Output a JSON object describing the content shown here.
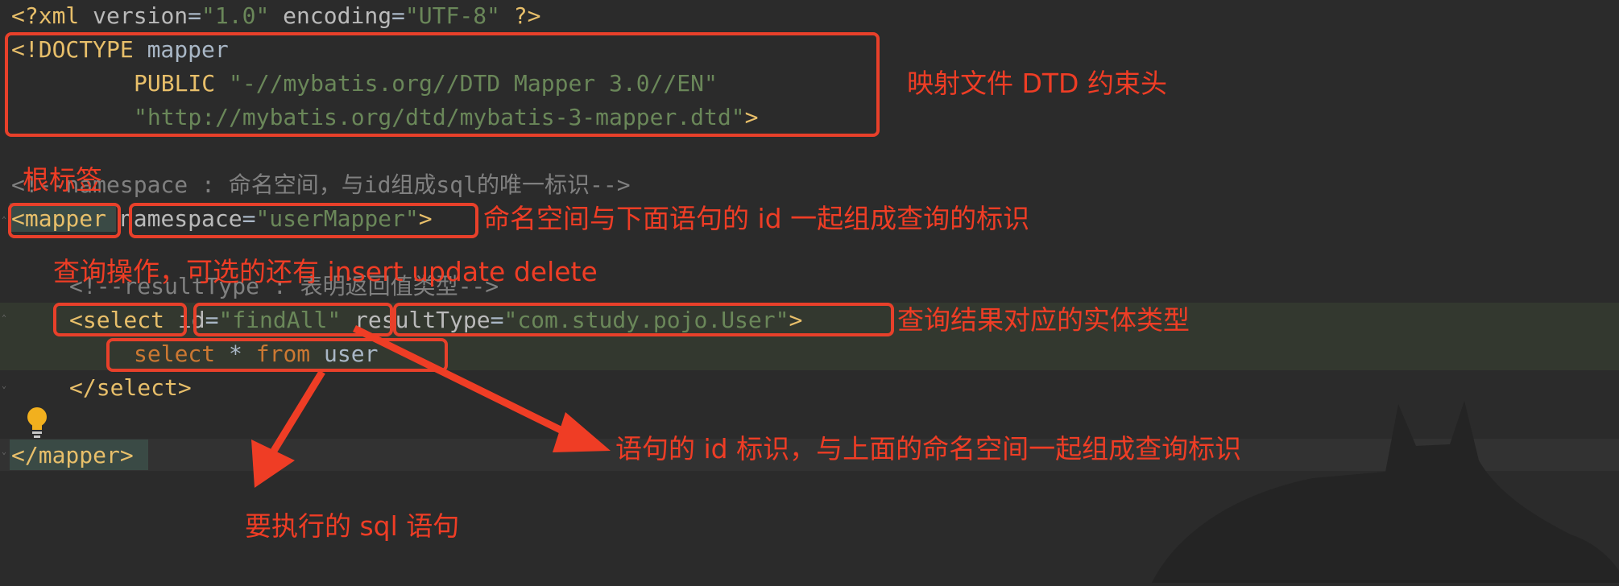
{
  "code": {
    "line1": {
      "open": "<?xml ",
      "attr1": "version",
      "eq1": "=",
      "val1": "\"1.0\"",
      "attr2": " encoding",
      "eq2": "=",
      "val2": "\"UTF-8\"",
      "close": " ?>"
    },
    "line2": {
      "tag": "<!DOCTYPE",
      "rest": " mapper"
    },
    "line3": {
      "kw": "PUBLIC",
      "val": " \"-//mybatis.org//DTD Mapper 3.0//EN\""
    },
    "line4": {
      "val": "\"http://mybatis.org/dtd/mybatis-3-mapper.dtd\"",
      "close": ">"
    },
    "line5": {
      "comment": "<!--namespace : 命名空间，与id组成sql的唯一标识-->"
    },
    "line6": {
      "tag": "<mapper",
      "attr": " namespace",
      "eq": "=",
      "val": "\"userMapper\"",
      "close": ">"
    },
    "line7": {
      "comment": "<!--resultType : 表明返回值类型-->"
    },
    "line8": {
      "tag": "<select",
      "attr1": " id",
      "eq1": "=",
      "val1": "\"findAll\"",
      "attr2": " resultType",
      "eq2": "=",
      "val2": "\"com.study.pojo.User\"",
      "close": ">"
    },
    "line9": {
      "kw1": "select",
      "star": " * ",
      "kw2": "from",
      "rest": " user"
    },
    "line10": {
      "tag": "</select>"
    },
    "line11": {
      "tag": "</mapper>"
    }
  },
  "annotations": {
    "dtd": "映射文件 DTD 约束头",
    "root": "根标签",
    "namespace": "命名空间与下面语句的 id 一起组成查询的标识",
    "select_op": "查询操作，可选的还有 insert update delete",
    "result_type": "查询结果对应的实体类型",
    "statement_id": "语句的 id 标识，与上面的命名空间一起组成查询标识",
    "sql": "要执行的 sql 语句"
  },
  "icons": {
    "bulb": "lightbulb-icon",
    "bat": "batman-silhouette-icon"
  },
  "colors": {
    "background": "#2b2b2b",
    "annotation": "#ef3d25",
    "tag": "#e8bf6a",
    "string": "#6a8759",
    "comment": "#808080"
  }
}
